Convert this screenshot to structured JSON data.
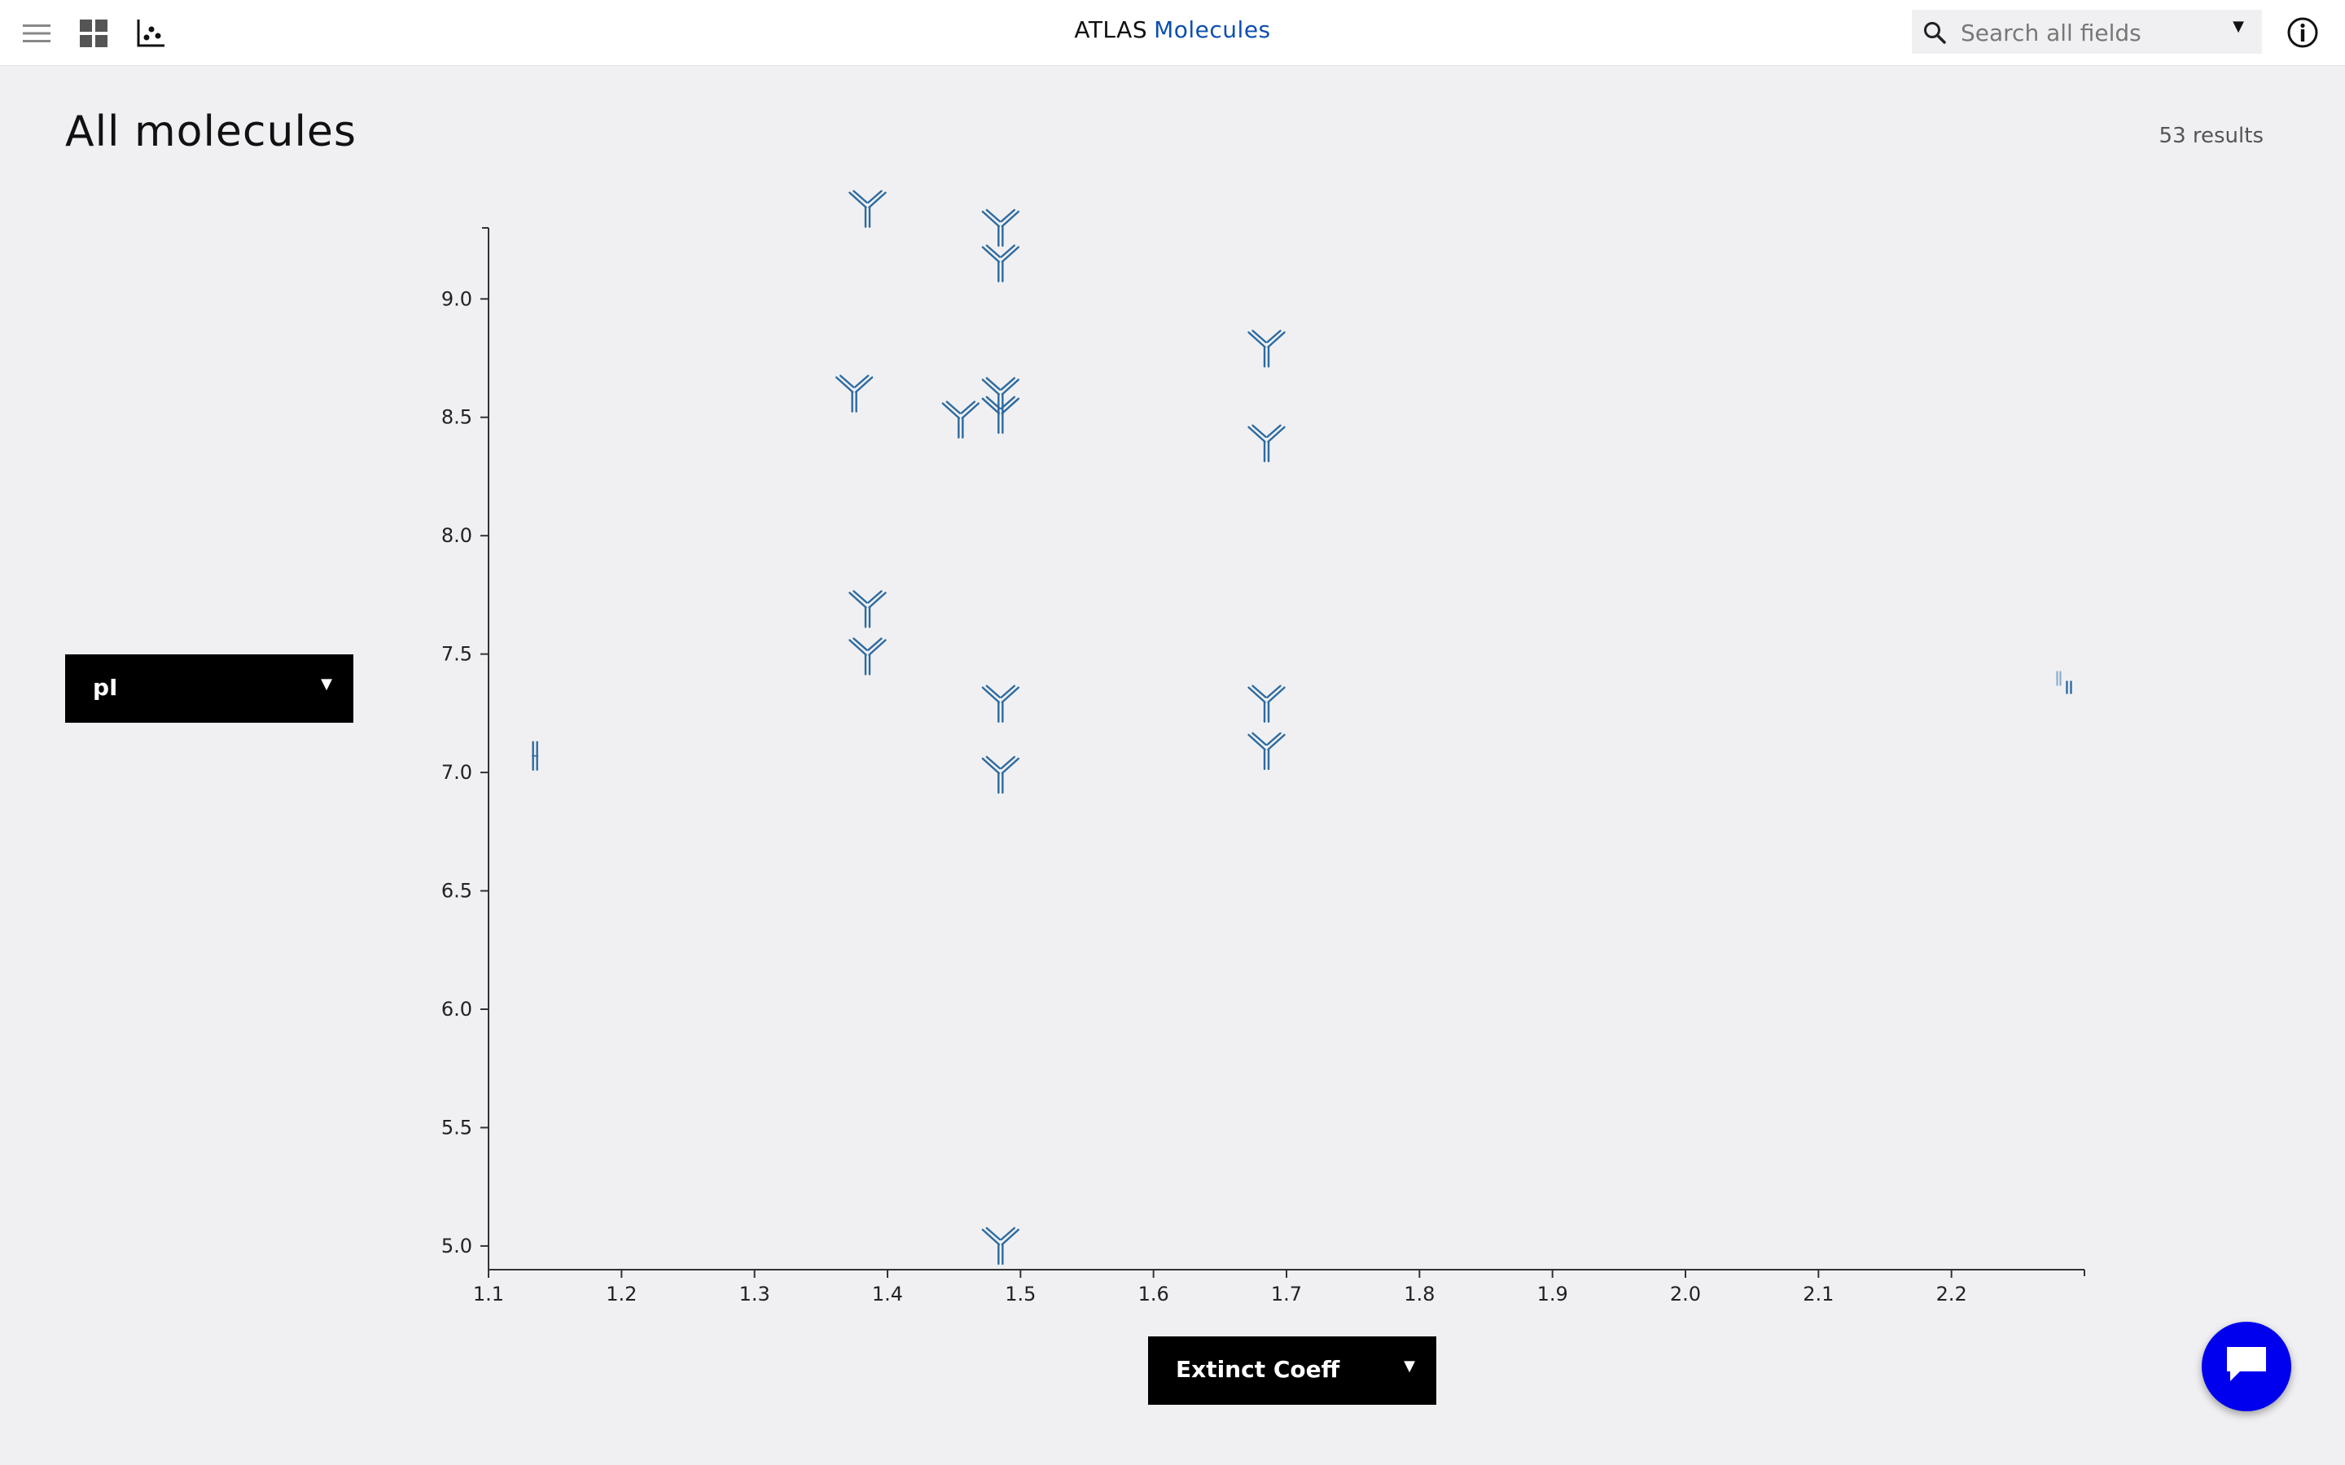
{
  "header": {
    "brand_prefix": "ATLAS",
    "brand_name": "Molecules",
    "menu_icon": "hamburger-menu-icon",
    "grid_icon": "grid-view-icon",
    "scatter_icon": "scatter-plot-view-icon",
    "search": {
      "placeholder": "Search all fields",
      "value": "",
      "icon": "search-icon"
    },
    "info_icon": "info-icon"
  },
  "main": {
    "title": "All molecules",
    "result_count": "53 results"
  },
  "controls": {
    "y_axis_label": "pI",
    "x_axis_label": "Extinct Coeff"
  },
  "chat": {
    "icon": "chat-bubble-icon"
  },
  "colors": {
    "accent": "#0d4fb0",
    "marker": "#2c6aa0",
    "chat": "#0000ee"
  },
  "chart_data": {
    "type": "scatter",
    "title": "",
    "xlabel": "Extinct Coeff",
    "ylabel": "pI",
    "xlim": [
      1.1,
      2.3
    ],
    "ylim": [
      4.9,
      9.3
    ],
    "xticks": [
      "1.1",
      "1.2",
      "1.3",
      "1.4",
      "1.5",
      "1.6",
      "1.7",
      "1.8",
      "1.9",
      "2.0",
      "2.1",
      "2.2"
    ],
    "yticks": [
      "5.0",
      "5.5",
      "6.0",
      "6.5",
      "7.0",
      "7.5",
      "8.0",
      "8.5",
      "9.0"
    ],
    "grid": false,
    "marker": "antibody-icon",
    "points": [
      {
        "x": 1.385,
        "y": 9.38,
        "shape": "antibody"
      },
      {
        "x": 1.485,
        "y": 9.3,
        "shape": "antibody"
      },
      {
        "x": 1.485,
        "y": 9.15,
        "shape": "antibody"
      },
      {
        "x": 1.685,
        "y": 8.79,
        "shape": "antibody"
      },
      {
        "x": 1.375,
        "y": 8.6,
        "shape": "antibody"
      },
      {
        "x": 1.485,
        "y": 8.59,
        "shape": "antibody"
      },
      {
        "x": 1.485,
        "y": 8.51,
        "shape": "antibody"
      },
      {
        "x": 1.455,
        "y": 8.49,
        "shape": "antibody"
      },
      {
        "x": 1.685,
        "y": 8.39,
        "shape": "antibody"
      },
      {
        "x": 1.385,
        "y": 7.69,
        "shape": "antibody"
      },
      {
        "x": 1.385,
        "y": 7.49,
        "shape": "antibody"
      },
      {
        "x": 1.485,
        "y": 7.29,
        "shape": "antibody"
      },
      {
        "x": 1.685,
        "y": 7.29,
        "shape": "antibody"
      },
      {
        "x": 1.685,
        "y": 7.09,
        "shape": "antibody"
      },
      {
        "x": 1.485,
        "y": 6.99,
        "shape": "antibody"
      },
      {
        "x": 1.485,
        "y": 5.0,
        "shape": "antibody"
      },
      {
        "x": 1.135,
        "y": 7.07,
        "shape": "fragment"
      },
      {
        "x": 2.285,
        "y": 7.38,
        "shape": "fragment-pair"
      }
    ]
  }
}
